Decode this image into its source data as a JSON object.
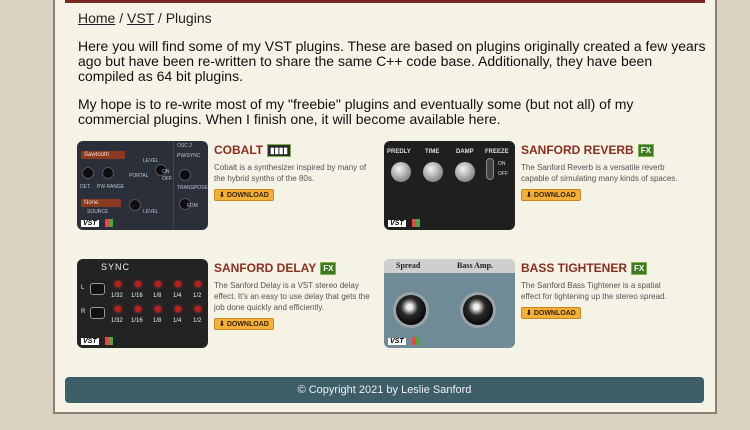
{
  "breadcrumb": {
    "home": "Home",
    "vst": "VST",
    "sep": "/",
    "current": "Plugins"
  },
  "intro": [
    "Here you will find some of my VST plugins. These are based on plugins originally created a few years ago but have been re-written to share the same C++ code base. Additionally, they have been compiled as 64 bit plugins.",
    "My hope is to re-write most of my \"freebie\" plugins and eventually some (but not all) of my commercial plugins. When I finish one, it will become available here."
  ],
  "download_label": "DOWNLOAD",
  "plugins": [
    {
      "title": "COBALT",
      "badge": "",
      "description": "Cobalt is a synthesizer inspired by many of the hybrid synths of the 80s."
    },
    {
      "title": "SANFORD REVERB",
      "badge": "FX",
      "description": "The Sanford Reverb is a versatile reverb capable of simulating many kinds of spaces."
    },
    {
      "title": "SANFORD DELAY",
      "badge": "FX",
      "description": "The Sanford Delay is a VST stereo delay effect. It's an easy to use delay that gets the job done quickly and efficiently."
    },
    {
      "title": "BASS TIGHTENER",
      "badge": "FX",
      "description": "The Sanford Bass Tightener is a spatial effect for tightening up the stereo spread."
    }
  ],
  "thumbs": {
    "cobalt": {
      "osc": "OSC 2",
      "sel1": "Sawtooth",
      "sel2": "None",
      "level": "LEVEL",
      "pw": "PW/SYNC",
      "portal": "PORTAL",
      "on": "ON",
      "off": "OFF",
      "det": "DET.",
      "pwange": "PW RANGE",
      "transpose": "TRANSPOSE",
      "source": "SOURCE",
      "fdm": "FDM",
      "level2": "LEVEL"
    },
    "reverb": {
      "knobs": [
        "PREDLY",
        "TIME",
        "DAMP"
      ],
      "freeze": "FREEZE",
      "on": "ON",
      "off": "OFF"
    },
    "delay": {
      "sync": "SYNC",
      "rows": [
        "L",
        "R"
      ],
      "divs": [
        "1/32",
        "1/16",
        "1/8",
        "1/4",
        "1/2"
      ]
    },
    "tightener": {
      "left": "Spread",
      "right": "Bass Amp."
    },
    "vst": "VST"
  },
  "footer": "© Copyright 2021 by Leslie Sanford"
}
